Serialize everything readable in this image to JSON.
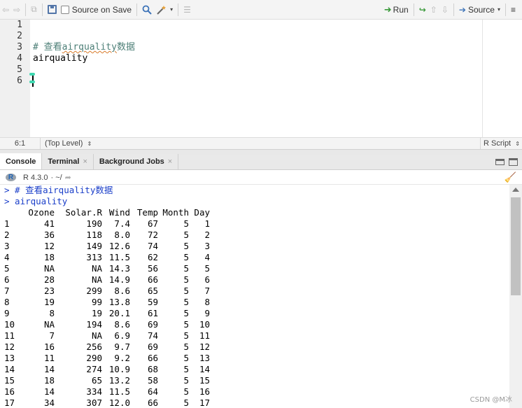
{
  "toolbar": {
    "source_on_save": "Source on Save",
    "run": "Run",
    "source": "Source"
  },
  "editor": {
    "line_numbers": [
      "1",
      "2",
      "3",
      "4",
      "5",
      "6"
    ],
    "line3_hash": "# ",
    "line3_cn1": "查看",
    "line3_word": "airquality",
    "line3_cn2": "数据",
    "line4": "airquality"
  },
  "status": {
    "position": "6:1",
    "scope": "(Top Level)",
    "file_type": "R Script"
  },
  "tabs": {
    "console": "Console",
    "terminal": "Terminal",
    "background_jobs": "Background Jobs",
    "close_glyph": "×"
  },
  "console_head": {
    "r_logo": "R",
    "version": "R 4.3.0",
    "path": "· ~/"
  },
  "console": {
    "line1": "> # 查看airquality数据",
    "line2": "> airquality",
    "columns": [
      "Ozone",
      "Solar.R",
      "Wind",
      "Temp",
      "Month",
      "Day"
    ],
    "rows": [
      [
        "1",
        "41",
        "190",
        "7.4",
        "67",
        "5",
        "1"
      ],
      [
        "2",
        "36",
        "118",
        "8.0",
        "72",
        "5",
        "2"
      ],
      [
        "3",
        "12",
        "149",
        "12.6",
        "74",
        "5",
        "3"
      ],
      [
        "4",
        "18",
        "313",
        "11.5",
        "62",
        "5",
        "4"
      ],
      [
        "5",
        "NA",
        "NA",
        "14.3",
        "56",
        "5",
        "5"
      ],
      [
        "6",
        "28",
        "NA",
        "14.9",
        "66",
        "5",
        "6"
      ],
      [
        "7",
        "23",
        "299",
        "8.6",
        "65",
        "5",
        "7"
      ],
      [
        "8",
        "19",
        "99",
        "13.8",
        "59",
        "5",
        "8"
      ],
      [
        "9",
        "8",
        "19",
        "20.1",
        "61",
        "5",
        "9"
      ],
      [
        "10",
        "NA",
        "194",
        "8.6",
        "69",
        "5",
        "10"
      ],
      [
        "11",
        "7",
        "NA",
        "6.9",
        "74",
        "5",
        "11"
      ],
      [
        "12",
        "16",
        "256",
        "9.7",
        "69",
        "5",
        "12"
      ],
      [
        "13",
        "11",
        "290",
        "9.2",
        "66",
        "5",
        "13"
      ],
      [
        "14",
        "14",
        "274",
        "10.9",
        "68",
        "5",
        "14"
      ],
      [
        "15",
        "18",
        "65",
        "13.2",
        "58",
        "5",
        "15"
      ],
      [
        "16",
        "14",
        "334",
        "11.5",
        "64",
        "5",
        "16"
      ],
      [
        "17",
        "34",
        "307",
        "12.0",
        "66",
        "5",
        "17"
      ]
    ]
  },
  "watermark": "CSDN @M冰"
}
